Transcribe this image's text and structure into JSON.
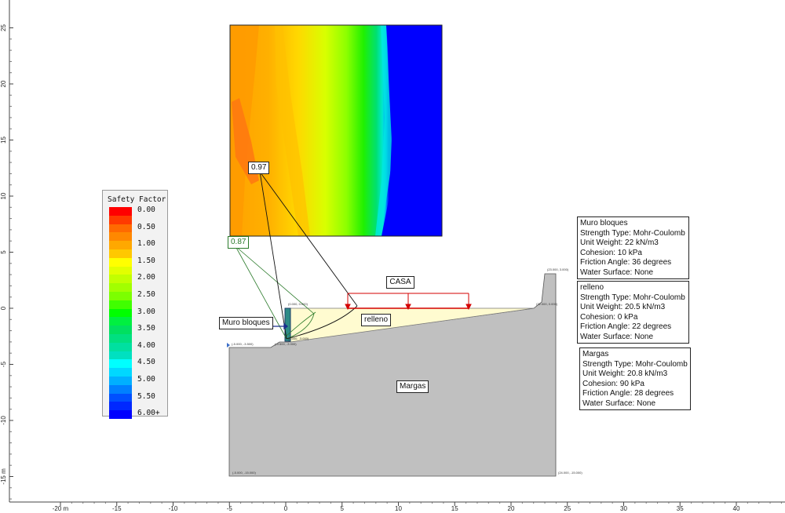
{
  "legend": {
    "title": "Safety Factor",
    "entries": [
      {
        "label": "0.00",
        "color": "#ff0000"
      },
      {
        "label": "",
        "color": "#ff3a00"
      },
      {
        "label": "0.50",
        "color": "#ff6a00"
      },
      {
        "label": "",
        "color": "#ff8800"
      },
      {
        "label": "1.00",
        "color": "#ffa800"
      },
      {
        "label": "",
        "color": "#ffc800"
      },
      {
        "label": "1.50",
        "color": "#ffff00"
      },
      {
        "label": "",
        "color": "#e2ff00"
      },
      {
        "label": "2.00",
        "color": "#c2ff00"
      },
      {
        "label": "",
        "color": "#a2ff00"
      },
      {
        "label": "2.50",
        "color": "#7cff00"
      },
      {
        "label": "",
        "color": "#40ff00"
      },
      {
        "label": "3.00",
        "color": "#00ff00"
      },
      {
        "label": "",
        "color": "#00f040"
      },
      {
        "label": "3.50",
        "color": "#00e060"
      },
      {
        "label": "",
        "color": "#00e080"
      },
      {
        "label": "4.00",
        "color": "#00e0a0"
      },
      {
        "label": "",
        "color": "#00e0c0"
      },
      {
        "label": "4.50",
        "color": "#00ffff"
      },
      {
        "label": "",
        "color": "#00d8ff"
      },
      {
        "label": "5.00",
        "color": "#00b0ff"
      },
      {
        "label": "",
        "color": "#0080ff"
      },
      {
        "label": "5.50",
        "color": "#0050ff"
      },
      {
        "label": "",
        "color": "#0028ff"
      },
      {
        "label": "6.00+",
        "color": "#0000ff"
      }
    ]
  },
  "x_axis": {
    "ticks": [
      {
        "label": "-20 m",
        "value": -20
      },
      {
        "label": "-15",
        "value": -15
      },
      {
        "label": "-10",
        "value": -10
      },
      {
        "label": "-5",
        "value": -5
      },
      {
        "label": "0",
        "value": 0
      },
      {
        "label": "5",
        "value": 5
      },
      {
        "label": "10",
        "value": 10
      },
      {
        "label": "15",
        "value": 15
      },
      {
        "label": "20",
        "value": 20
      },
      {
        "label": "25",
        "value": 25
      },
      {
        "label": "30",
        "value": 30
      },
      {
        "label": "35",
        "value": 35
      },
      {
        "label": "40",
        "value": 40
      }
    ]
  },
  "y_axis": {
    "ticks": [
      {
        "label": "25",
        "value": 25
      },
      {
        "label": "20",
        "value": 20
      },
      {
        "label": "15",
        "value": 15
      },
      {
        "label": "10",
        "value": 10
      },
      {
        "label": "5",
        "value": 5
      },
      {
        "label": "0",
        "value": 0
      },
      {
        "label": "-5",
        "value": -5
      },
      {
        "label": "-10",
        "value": -10
      },
      {
        "label": "-15 m",
        "value": -15
      }
    ]
  },
  "safety_factors": {
    "global_min": "0.97",
    "secondary": "0.87"
  },
  "regions": {
    "muro": "Muro bloques",
    "relleno": "relleno",
    "margas": "Margas",
    "load": "CASA"
  },
  "materials": [
    {
      "name": "Muro bloques",
      "lines": [
        "Muro bloques",
        "Strength Type: Mohr-Coulomb",
        "Unit Weight: 22 kN/m3",
        "Cohesion: 10 kPa",
        "Friction Angle: 36 degrees",
        "Water Surface: None"
      ]
    },
    {
      "name": "relleno",
      "lines": [
        "relleno",
        "Strength Type: Mohr-Coulomb",
        "Unit Weight: 20.5 kN/m3",
        "Cohesion: 0 kPa",
        "Friction Angle: 22 degrees",
        "Water Surface: None"
      ]
    },
    {
      "name": "Margas",
      "lines": [
        "Margas",
        "Strength Type: Mohr-Coulomb",
        "Unit Weight: 20.8 kN/m3",
        "Cohesion: 90 kPa",
        "Friction Angle: 28 degrees",
        "Water Surface: None"
      ]
    }
  ],
  "vertex_labels": {
    "v1": "(-5.000, -3.500)",
    "v2": "(-5.000, -15.000)",
    "v3": "(0.000, 0.000)",
    "v4": "(0.000, -3.000)",
    "v5": "(-0.500, -3.000)",
    "v6": "(22.000, 0.000)",
    "v7": "(23.000, 3.000)",
    "v8": "(24.000, -15.000)"
  }
}
